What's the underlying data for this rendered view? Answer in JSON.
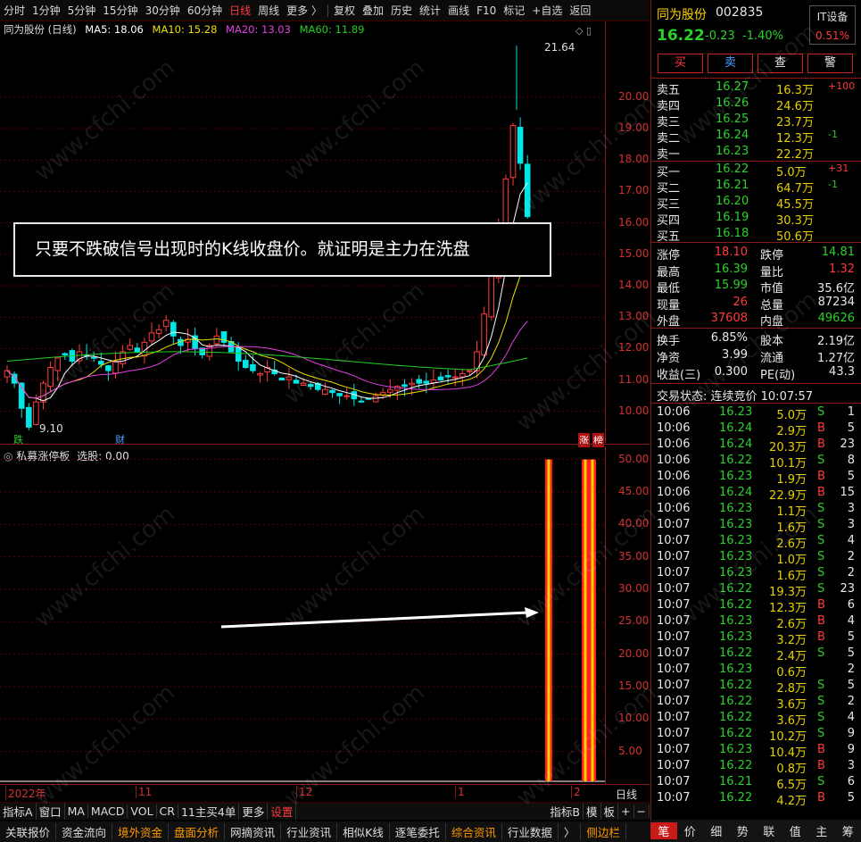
{
  "toolbar": {
    "periods": [
      "分时",
      "1分钟",
      "5分钟",
      "15分钟",
      "30分钟",
      "60分钟",
      "日线",
      "周线",
      "更多 〉"
    ],
    "active": "日线",
    "tools": [
      "复权",
      "叠加",
      "历史",
      "统计",
      "画线",
      "F10",
      "标记",
      "+自选",
      "返回"
    ]
  },
  "chart_legend": {
    "title": "同为股份 (日线)",
    "ma5": "MA5: 18.06",
    "ma10": "MA10: 15.28",
    "ma20": "MA20: 13.03",
    "ma60": "MA60: 11.89",
    "colors": {
      "ma5": "#ffffff",
      "ma10": "#e8e000",
      "ma20": "#e040e0",
      "ma60": "#20d020"
    }
  },
  "price_axis": [
    "20.00",
    "19.00",
    "18.00",
    "17.00",
    "16.00",
    "15.00",
    "14.00",
    "13.00",
    "12.00",
    "11.00",
    "10.00"
  ],
  "price_labels": {
    "high": "21.64",
    "low": "9.10"
  },
  "markers": {
    "die": "跌",
    "cai": "财",
    "zhang": "涨",
    "bang": "榜"
  },
  "annotation": "只要不跌破信号出现时的K线收盘价。就证明是主力在洗盘",
  "indicator": {
    "title": "私募涨停板",
    "xuangu": "选股: 0.00",
    "axis": [
      "50.00",
      "45.00",
      "40.00",
      "35.00",
      "30.00",
      "25.00",
      "20.00",
      "15.00",
      "10.00",
      "5.00"
    ]
  },
  "date_axis": {
    "labels": [
      "2022年",
      "11",
      "12",
      "1",
      "2"
    ],
    "period": "日线"
  },
  "bottom_tabs": [
    "指标A",
    "窗口",
    "MA",
    "MACD",
    "VOL",
    "CR",
    "11主买4单",
    "更多",
    "设置"
  ],
  "bottom_tabs_right": [
    "指标B",
    "模",
    "板",
    "+",
    "−"
  ],
  "bottom_links": [
    "关联报价",
    "资金流向",
    "境外资金",
    "盘面分析",
    "网摘资讯",
    "行业资讯",
    "相似K线",
    "逐笔委托",
    "综合资讯",
    "行业数据",
    "〉",
    "侧边栏"
  ],
  "stock": {
    "name": "同为股份",
    "code": "002835",
    "sector": "IT设备",
    "sector_pct": "0.51%",
    "price": "16.22",
    "change": "-0.23",
    "change_pct": "-1.40%"
  },
  "trade_buttons": [
    "买",
    "卖",
    "查",
    "警"
  ],
  "asks": [
    {
      "label": "卖五",
      "price": "16.27",
      "vol": "16.3万",
      "chg": "+100"
    },
    {
      "label": "卖四",
      "price": "16.26",
      "vol": "24.6万",
      "chg": ""
    },
    {
      "label": "卖三",
      "price": "16.25",
      "vol": "23.7万",
      "chg": ""
    },
    {
      "label": "卖二",
      "price": "16.24",
      "vol": "12.3万",
      "chg": "-1"
    },
    {
      "label": "卖一",
      "price": "16.23",
      "vol": "22.2万",
      "chg": ""
    }
  ],
  "bids": [
    {
      "label": "买一",
      "price": "16.22",
      "vol": "5.0万",
      "chg": "+31"
    },
    {
      "label": "买二",
      "price": "16.21",
      "vol": "64.7万",
      "chg": "-1"
    },
    {
      "label": "买三",
      "price": "16.20",
      "vol": "45.5万",
      "chg": ""
    },
    {
      "label": "买四",
      "price": "16.19",
      "vol": "30.3万",
      "chg": ""
    },
    {
      "label": "买五",
      "price": "16.18",
      "vol": "50.6万",
      "chg": ""
    }
  ],
  "stats": [
    [
      "涨停",
      "18.10",
      "跌停",
      "14.81"
    ],
    [
      "最高",
      "16.39",
      "量比",
      "1.32"
    ],
    [
      "最低",
      "15.99",
      "市值",
      "35.6亿"
    ],
    [
      "现量",
      "26",
      "总量",
      "87234"
    ],
    [
      "外盘",
      "37608",
      "内盘",
      "49626"
    ]
  ],
  "stats2": [
    [
      "换手",
      "6.85%",
      "股本",
      "2.19亿"
    ],
    [
      "净资",
      "3.99",
      "流通",
      "1.27亿"
    ],
    [
      "收益(三)",
      "0.300",
      "PE(动)",
      "43.3"
    ]
  ],
  "status": "交易状态: 连续竞价 10:07:57",
  "ticks": [
    [
      "10:06",
      "16.23",
      "5.0万",
      "S",
      "1"
    ],
    [
      "10:06",
      "16.24",
      "2.9万",
      "B",
      "5"
    ],
    [
      "10:06",
      "16.24",
      "20.3万",
      "B",
      "23"
    ],
    [
      "10:06",
      "16.22",
      "10.1万",
      "S",
      "8"
    ],
    [
      "10:06",
      "16.23",
      "1.9万",
      "B",
      "5"
    ],
    [
      "10:06",
      "16.24",
      "22.9万",
      "B",
      "15"
    ],
    [
      "10:06",
      "16.23",
      "1.1万",
      "S",
      "3"
    ],
    [
      "10:07",
      "16.23",
      "1.6万",
      "S",
      "3"
    ],
    [
      "10:07",
      "16.23",
      "2.6万",
      "S",
      "4"
    ],
    [
      "10:07",
      "16.23",
      "1.0万",
      "S",
      "2"
    ],
    [
      "10:07",
      "16.23",
      "1.6万",
      "S",
      "2"
    ],
    [
      "10:07",
      "16.22",
      "19.3万",
      "S",
      "23"
    ],
    [
      "10:07",
      "16.22",
      "12.3万",
      "B",
      "6"
    ],
    [
      "10:07",
      "16.23",
      "2.6万",
      "B",
      "4"
    ],
    [
      "10:07",
      "16.23",
      "3.2万",
      "B",
      "5"
    ],
    [
      "10:07",
      "16.22",
      "2.4万",
      "S",
      "5"
    ],
    [
      "10:07",
      "16.23",
      "0.6万",
      "",
      "2"
    ],
    [
      "10:07",
      "16.22",
      "2.8万",
      "S",
      "5"
    ],
    [
      "10:07",
      "16.22",
      "3.6万",
      "S",
      "2"
    ],
    [
      "10:07",
      "16.22",
      "3.6万",
      "S",
      "4"
    ],
    [
      "10:07",
      "16.22",
      "10.2万",
      "S",
      "9"
    ],
    [
      "10:07",
      "16.23",
      "10.4万",
      "B",
      "9"
    ],
    [
      "10:07",
      "16.22",
      "0.8万",
      "B",
      "3"
    ],
    [
      "10:07",
      "16.21",
      "6.5万",
      "S",
      "6"
    ],
    [
      "10:07",
      "16.22",
      "4.2万",
      "B",
      "5"
    ]
  ],
  "side_tabs": [
    "笔",
    "价",
    "细",
    "势",
    "联",
    "值",
    "主",
    "筹"
  ],
  "watermark": "www.cfchi.com"
}
